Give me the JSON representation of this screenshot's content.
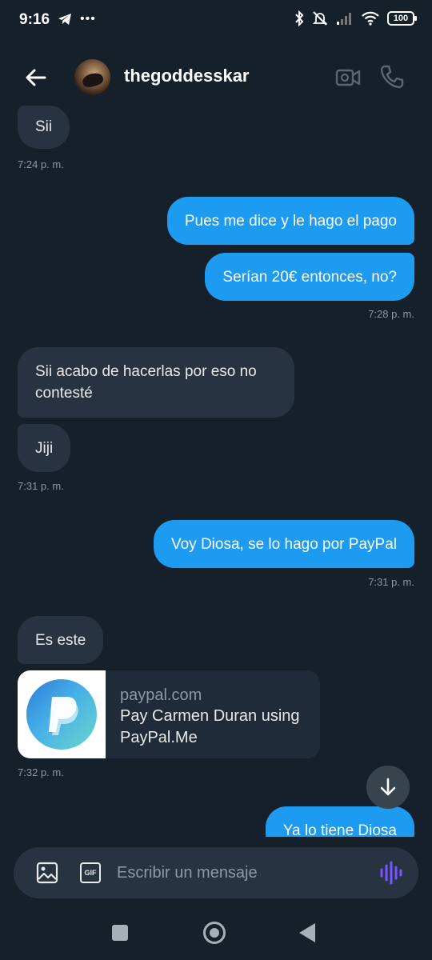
{
  "status_bar": {
    "time": "9:16",
    "battery": "100"
  },
  "header": {
    "username": "thegoddesskar"
  },
  "messages": [
    {
      "text": "Sii",
      "direction": "in"
    },
    {
      "timestamp": "7:24 p. m."
    },
    {
      "text": "Pues me dice y le hago el pago",
      "direction": "out"
    },
    {
      "text": "Serían 20€ entonces, no?",
      "direction": "out"
    },
    {
      "timestamp": "7:28 p. m."
    },
    {
      "text": "Sii acabo de hacerlas por eso no contesté",
      "direction": "in"
    },
    {
      "text": "Jiji",
      "direction": "in"
    },
    {
      "timestamp": "7:31 p. m."
    },
    {
      "text": "Voy Diosa, se lo hago por PayPal",
      "direction": "out"
    },
    {
      "timestamp": "7:31 p. m."
    },
    {
      "text": "Es este",
      "direction": "in"
    },
    {
      "timestamp": "7:32 p. m."
    },
    {
      "text": "Ya lo tiene Diosa",
      "direction": "out"
    }
  ],
  "link_card": {
    "domain": "paypal.com",
    "title": "Pay Carmen Duran using PayPal.Me"
  },
  "composer": {
    "placeholder": "Escribir un mensaje",
    "gif_label": "GIF"
  },
  "colors": {
    "background": "#15202b",
    "outgoing_bubble": "#1d9bf0",
    "incoming_bubble": "#273340",
    "voice_icon": "#7856ff"
  },
  "icons": [
    "back-arrow-icon",
    "video-camera-icon",
    "phone-icon",
    "image-icon",
    "gif-icon",
    "voice-waveform-icon",
    "arrow-down-icon",
    "paypal-logo-icon"
  ]
}
